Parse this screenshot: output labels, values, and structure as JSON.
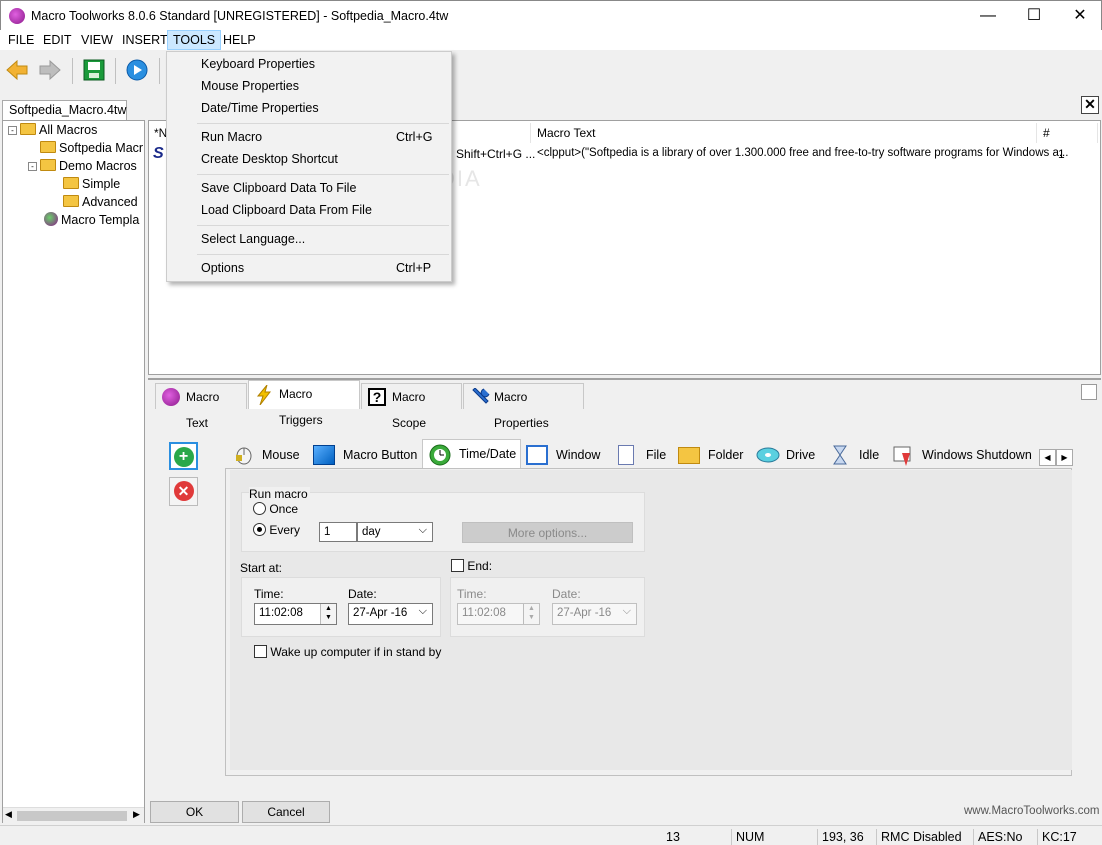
{
  "window": {
    "title": "Macro Toolworks 8.0.6 Standard [UNREGISTERED] - Softpedia_Macro.4tw"
  },
  "menu": [
    "FILE",
    "EDIT",
    "VIEW",
    "INSERT",
    "TOOLS",
    "HELP"
  ],
  "tools_menu": {
    "items": [
      {
        "label": "Keyboard Properties",
        "shortcut": ""
      },
      {
        "label": "Mouse Properties",
        "shortcut": ""
      },
      {
        "label": "Date/Time Properties",
        "shortcut": ""
      },
      {
        "label": "Run Macro",
        "shortcut": "Ctrl+G"
      },
      {
        "label": "Create Desktop Shortcut",
        "shortcut": ""
      },
      {
        "label": "Save Clipboard Data To File",
        "shortcut": ""
      },
      {
        "label": "Load Clipboard Data From File",
        "shortcut": ""
      },
      {
        "label": "Select Language...",
        "shortcut": ""
      },
      {
        "label": "Options",
        "shortcut": "Ctrl+P"
      }
    ]
  },
  "doc_tab": "Softpedia_Macro.4tw",
  "tree": [
    {
      "label": "All Macros",
      "level": 0
    },
    {
      "label": "Softpedia Macr",
      "level": 1
    },
    {
      "label": "Demo Macros",
      "level": 1
    },
    {
      "label": "Simple",
      "level": 2
    },
    {
      "label": "Advanced",
      "level": 2
    },
    {
      "label": "Macro Templa",
      "level": 1
    }
  ],
  "list": {
    "columns": [
      "*N",
      "Macro Text",
      "#"
    ],
    "row": {
      "name_icon": "S",
      "trigger": "Shift+Ctrl+G ...",
      "text": "<clpput>(\"Softpedia is a library of over 1.300.000 free and free-to-try software programs for Windows a...",
      "count": "1"
    },
    "watermark": "SOFTPEDIA"
  },
  "main_tabs": [
    "Macro Text",
    "Macro Triggers",
    "Macro Scope",
    "Macro Properties"
  ],
  "trigger_tabs": [
    "Mouse",
    "Macro Button",
    "Time/Date",
    "Window",
    "File",
    "Folder",
    "Drive",
    "Idle",
    "Windows Shutdown"
  ],
  "timedate": {
    "run_macro_label": "Run macro",
    "once_label": "Once",
    "every_label": "Every",
    "every_value": "1",
    "unit": "day",
    "more_options": "More options...",
    "start_at_label": "Start at:",
    "end_label": "End:",
    "time_label": "Time:",
    "date_label": "Date:",
    "start_time": "11:02:08",
    "start_date": "27-Apr -16",
    "end_time": "11:02:08",
    "end_date": "27-Apr -16",
    "wake_label": "Wake up computer if in stand by"
  },
  "buttons": {
    "ok": "OK",
    "cancel": "Cancel"
  },
  "website": "www.MacroToolworks.com",
  "status": {
    "count": "13",
    "num": "NUM",
    "pos": "193,  36",
    "rmc": "RMC Disabled",
    "aes": "AES:No",
    "kc": "KC:17"
  },
  "colors": {
    "accent": "#0078d7",
    "menu_highlight": "#cce8ff",
    "folder": "#f4c542"
  }
}
